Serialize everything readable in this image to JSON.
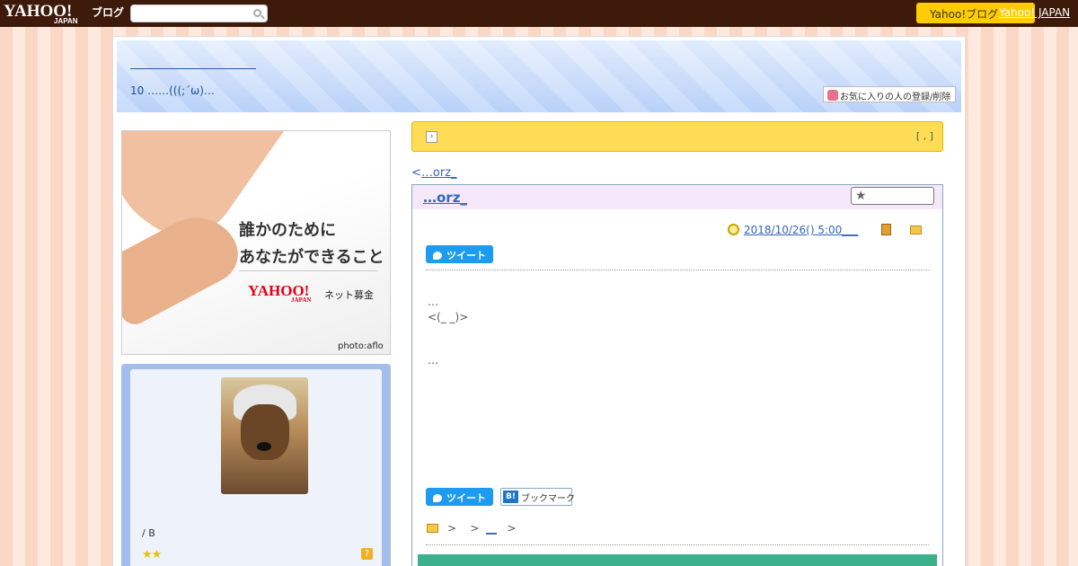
{
  "topbar": {
    "logo": "YAHOO!",
    "logo_sub": "JAPAN",
    "logo_blog": "ブログ",
    "search_placeholder": "",
    "yahoo_button": "Yahoo!ブログ",
    "yahoo_link": "Yahoo! JAPAN"
  },
  "header": {
    "subtitle": "10 ……(((;´ω)…",
    "fav_button": "お気に入りの人の登録/削除"
  },
  "banner": {
    "line1": "誰かのために",
    "line2": "あなたができること",
    "brand": "YAHOO!",
    "brand_sub": "JAPAN",
    "service": "ネット募金",
    "credit": "photo:aflo"
  },
  "profile": {
    "label": "/ B",
    "stars": "★★",
    "help": "?"
  },
  "notice": {
    "arrow": "›",
    "right": "[ , ]"
  },
  "nav": {
    "prev_prefix": "<",
    "prev_link": "…orz_"
  },
  "article": {
    "title": "…orz_",
    "star_icon": "★",
    "date": "2018/10/26()  5:00___",
    "tweet": "ツイート",
    "hatena_icon": "B!",
    "hatena": "ブックマーク",
    "body_line1": "…",
    "body_line2": "<(_ _)>",
    "body_line3": "…",
    "crumb_sep1": ">",
    "crumb_sep2": ">",
    "crumb_link": "__",
    "crumb_sep3": ">"
  }
}
